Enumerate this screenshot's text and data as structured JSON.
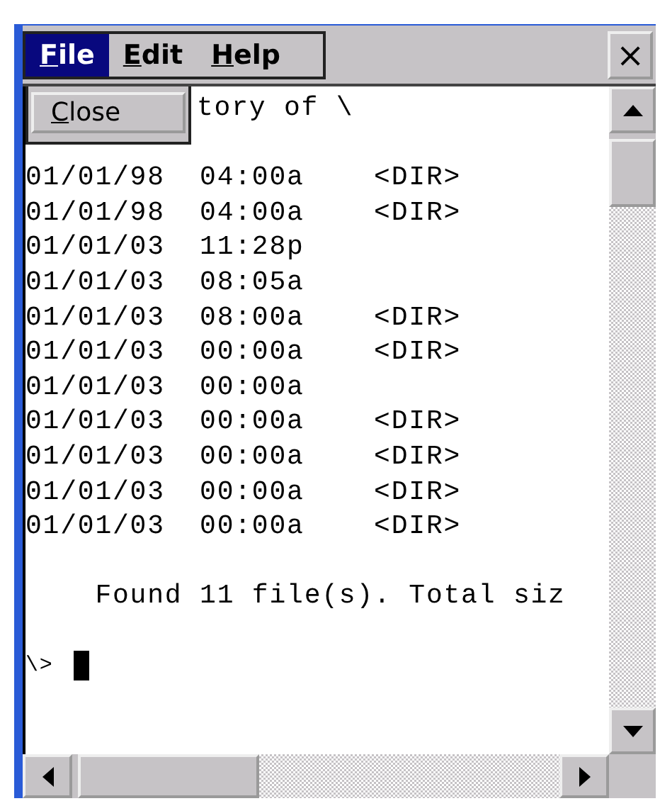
{
  "menu": [
    {
      "label": "File",
      "selected": true
    },
    {
      "label": "Edit",
      "selected": false
    },
    {
      "label": "Help",
      "selected": false
    }
  ],
  "close_button": "×",
  "dropdown": {
    "items": [
      "Close"
    ]
  },
  "console": {
    "header": "tory of \\",
    "lines": [
      "01/01/98  04:00a    <DIR>",
      "01/01/98  04:00a    <DIR>",
      "01/01/03  11:28p",
      "01/01/03  08:05a",
      "01/01/03  08:00a    <DIR>",
      "01/01/03  00:00a    <DIR>",
      "01/01/03  00:00a",
      "01/01/03  00:00a    <DIR>",
      "01/01/03  00:00a    <DIR>",
      "01/01/03  00:00a    <DIR>",
      "01/01/03  00:00a    <DIR>"
    ],
    "summary": "    Found 11 file(s). Total siz",
    "prompt": "\\>"
  }
}
